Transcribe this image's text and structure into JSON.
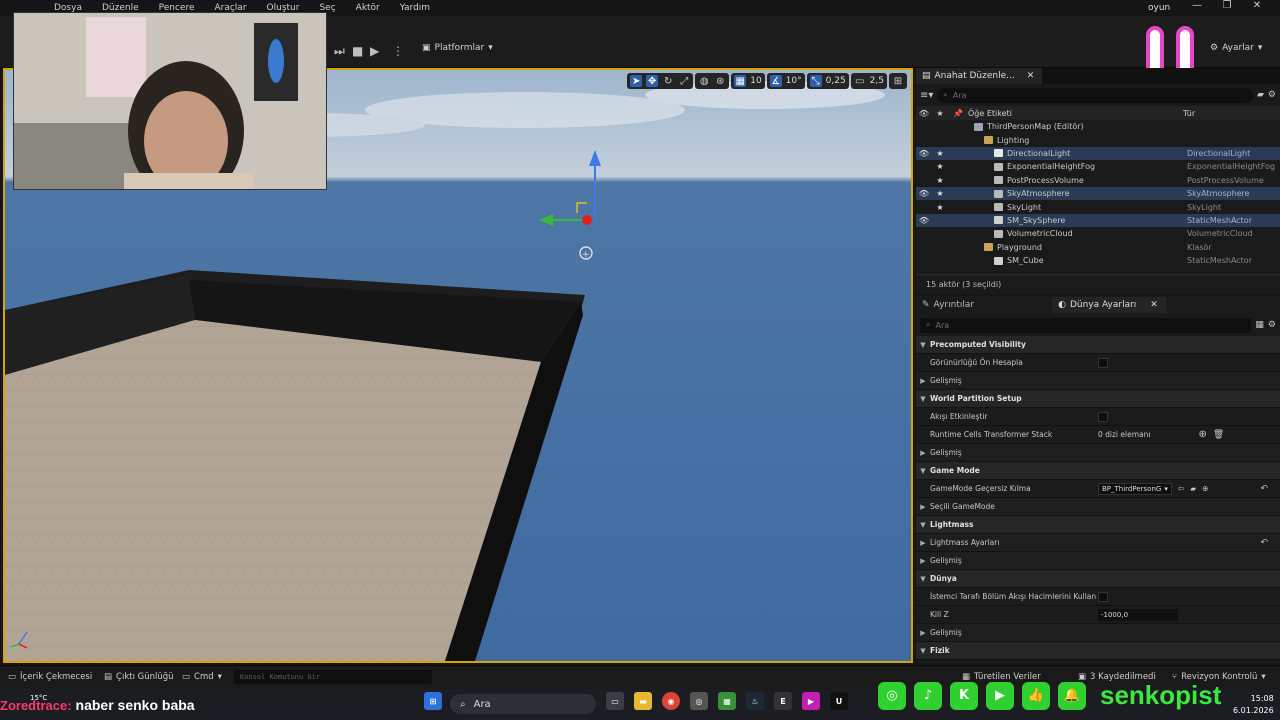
{
  "menu": [
    "Dosya",
    "Düzenle",
    "Pencere",
    "Araçlar",
    "Oluştur",
    "Seç",
    "Aktör",
    "Yardım"
  ],
  "project_name": "oyun",
  "toolbar": {
    "platforms_label": "Platformlar",
    "settings_label": "Ayarlar"
  },
  "viewport": {
    "grid_snap": "10",
    "rotation_snap": "10°",
    "scale_snap": "0,25",
    "camera_speed": "2,5"
  },
  "outliner": {
    "tab_label": "Anahat Düzenle...",
    "search_placeholder": "Ara",
    "col_label": "Öğe Etiketi",
    "col_type": "Tür",
    "rows": [
      {
        "indent": 58,
        "label": "ThirdPersonMap (Editör)",
        "type": "",
        "icon": "map",
        "vis": "",
        "star": "",
        "sel": false
      },
      {
        "indent": 68,
        "label": "Lighting",
        "type": "",
        "icon": "folder",
        "vis": "",
        "star": "",
        "sel": false
      },
      {
        "indent": 78,
        "label": "DirectionalLight",
        "type": "DirectionalLight",
        "icon": "light",
        "vis": "👁",
        "star": "★",
        "sel": true
      },
      {
        "indent": 78,
        "label": "ExponentialHeightFog",
        "type": "ExponentialHeightFog",
        "icon": "actor",
        "vis": "",
        "star": "★",
        "sel": false
      },
      {
        "indent": 78,
        "label": "PostProcessVolume",
        "type": "PostProcessVolume",
        "icon": "actor",
        "vis": "",
        "star": "★",
        "sel": false
      },
      {
        "indent": 78,
        "label": "SkyAtmosphere",
        "type": "SkyAtmosphere",
        "icon": "actor",
        "vis": "👁",
        "star": "★",
        "sel": true
      },
      {
        "indent": 78,
        "label": "SkyLight",
        "type": "SkyLight",
        "icon": "actor",
        "vis": "",
        "star": "★",
        "sel": false
      },
      {
        "indent": 78,
        "label": "SM_SkySphere",
        "type": "StaticMeshActor",
        "icon": "mesh",
        "vis": "👁",
        "star": "",
        "sel": true
      },
      {
        "indent": 78,
        "label": "VolumetricCloud",
        "type": "VolumetricCloud",
        "icon": "actor",
        "vis": "",
        "star": "",
        "sel": false
      },
      {
        "indent": 68,
        "label": "Playground",
        "type": "Klasör",
        "icon": "folder",
        "vis": "",
        "star": "",
        "sel": false
      },
      {
        "indent": 78,
        "label": "SM_Cube",
        "type": "StaticMeshActor",
        "icon": "mesh",
        "vis": "",
        "star": "",
        "sel": false
      }
    ],
    "footer": "15 aktör (3 seçildi)"
  },
  "details": {
    "tab_details": "Ayrıntılar",
    "tab_world": "Dünya Ayarları",
    "search_placeholder": "Ara",
    "rows": [
      {
        "kind": "cat",
        "label": "Precomputed Visibility"
      },
      {
        "kind": "prop",
        "label": "Görünürlüğü Ön Hesapla",
        "control": "check"
      },
      {
        "kind": "sub",
        "label": "Gelişmiş"
      },
      {
        "kind": "cat",
        "label": "World Partition Setup"
      },
      {
        "kind": "prop",
        "label": "Akışı Etkinleştir",
        "control": "check"
      },
      {
        "kind": "prop",
        "label": "Runtime Cells Transformer Stack",
        "control": "text",
        "value": "0 dizi elemanı"
      },
      {
        "kind": "sub",
        "label": "Gelişmiş"
      },
      {
        "kind": "cat",
        "label": "Game Mode"
      },
      {
        "kind": "prop",
        "label": "GameMode Geçersiz Kılma",
        "control": "combo",
        "value": "BP_ThirdPersonG"
      },
      {
        "kind": "sub",
        "label": "Seçili GameMode"
      },
      {
        "kind": "cat",
        "label": "Lightmass"
      },
      {
        "kind": "sub",
        "label": "Lightmass Ayarları"
      },
      {
        "kind": "sub",
        "label": "Gelişmiş"
      },
      {
        "kind": "cat",
        "label": "Dünya"
      },
      {
        "kind": "prop",
        "label": "İstemci Tarafı Bölüm Akışı Hacimlerini Kullan",
        "control": "check"
      },
      {
        "kind": "prop",
        "label": "Kill Z",
        "control": "num",
        "value": "-1000,0"
      },
      {
        "kind": "sub",
        "label": "Gelişmiş"
      },
      {
        "kind": "cat",
        "label": "Fizik"
      }
    ]
  },
  "statusbar": {
    "content_drawer": "İçerik Çekmecesi",
    "output_log": "Çıktı Günlüğü",
    "cmd": "Cmd",
    "console_placeholder": "Konsol Komutunu Gir",
    "derived": "Türetilen Veriler",
    "unsaved": "3 Kaydedilmedi",
    "revision": "Revizyon Kontrolü"
  },
  "chat": {
    "user": "Zoredtrace:",
    "message": "naber senko baba"
  },
  "weather": "15°C",
  "taskbar": {
    "search": "Ara"
  },
  "clock": {
    "time": "15:08",
    "date": "6.01.2026"
  },
  "social": {
    "brand": "senkopist"
  },
  "colors": {
    "selection_outline": "#d6a600",
    "sky": "#4e77a6",
    "brand_green": "#3de83d",
    "chat_user": "#ff3a6a",
    "overlay_pink": "#e646c8"
  }
}
